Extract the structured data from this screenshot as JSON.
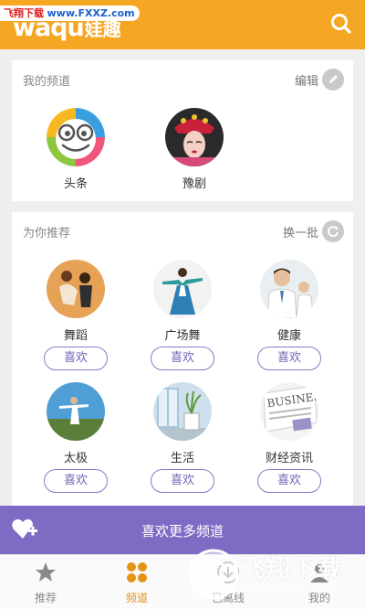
{
  "watermark": {
    "top_left_red": "飞翔下载",
    "top_left_blue": "www.FXXZ.com",
    "big": "飞翔下载",
    "url": "WWW.FXXZ.COM"
  },
  "header": {
    "logo_text": "waqu",
    "logo_cn": "娃趣",
    "search_icon": "search-icon",
    "color": "#f5a623"
  },
  "my_channels": {
    "title": "我的频道",
    "action_label": "编辑",
    "action_icon": "pencil-icon",
    "items": [
      {
        "label": "头条"
      },
      {
        "label": "豫剧"
      }
    ]
  },
  "recommend": {
    "title": "为你推荐",
    "action_label": "换一批",
    "action_icon": "refresh-icon",
    "like_label": "喜欢",
    "items": [
      {
        "label": "舞蹈"
      },
      {
        "label": "广场舞"
      },
      {
        "label": "健康"
      },
      {
        "label": "太极"
      },
      {
        "label": "生活"
      },
      {
        "label": "财经资讯"
      }
    ]
  },
  "more_bar": {
    "label": "喜欢更多频道",
    "icon": "heart-plus-icon",
    "color": "#7e6bc4"
  },
  "tabs": [
    {
      "label": "推荐",
      "icon": "star-icon",
      "active": false
    },
    {
      "label": "频道",
      "icon": "grid-icon",
      "active": true
    },
    {
      "label": "已离线",
      "icon": "download-icon",
      "active": false
    },
    {
      "label": "我的",
      "icon": "user-icon",
      "active": false
    }
  ]
}
